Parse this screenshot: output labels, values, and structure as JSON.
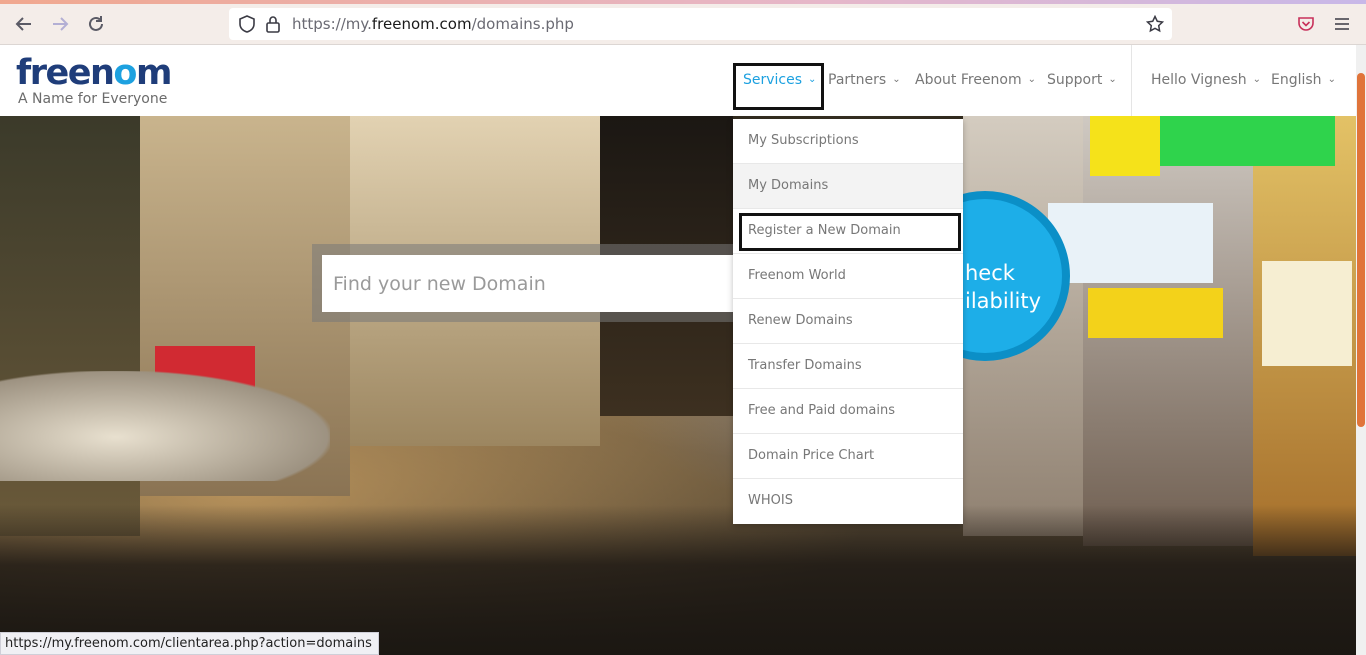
{
  "browser": {
    "url_prefix": "https://my.",
    "url_domain": "freenom.com",
    "url_suffix": "/domains.php",
    "status_url": "https://my.freenom.com/clientarea.php?action=domains"
  },
  "site": {
    "logo_part1": "freen",
    "logo_part2": "o",
    "logo_part3": "m",
    "tagline": "A Name for Everyone"
  },
  "nav": {
    "services": "Services",
    "partners": "Partners",
    "about": "About Freenom",
    "support": "Support",
    "user": "Hello Vignesh",
    "language": "English"
  },
  "hero": {
    "search_placeholder": "Find your new Domain",
    "check_line1": "heck",
    "check_line2": "ilability"
  },
  "services_menu": {
    "items": [
      "My Subscriptions",
      "My Domains",
      "Register a New Domain",
      "Freenom World",
      "Renew Domains",
      "Transfer Domains",
      "Free and Paid domains",
      "Domain Price Chart",
      "WHOIS"
    ]
  },
  "colors": {
    "accent": "#1da1e0",
    "logo_dark": "#1f3d7a",
    "check_button": "#1daee8"
  }
}
